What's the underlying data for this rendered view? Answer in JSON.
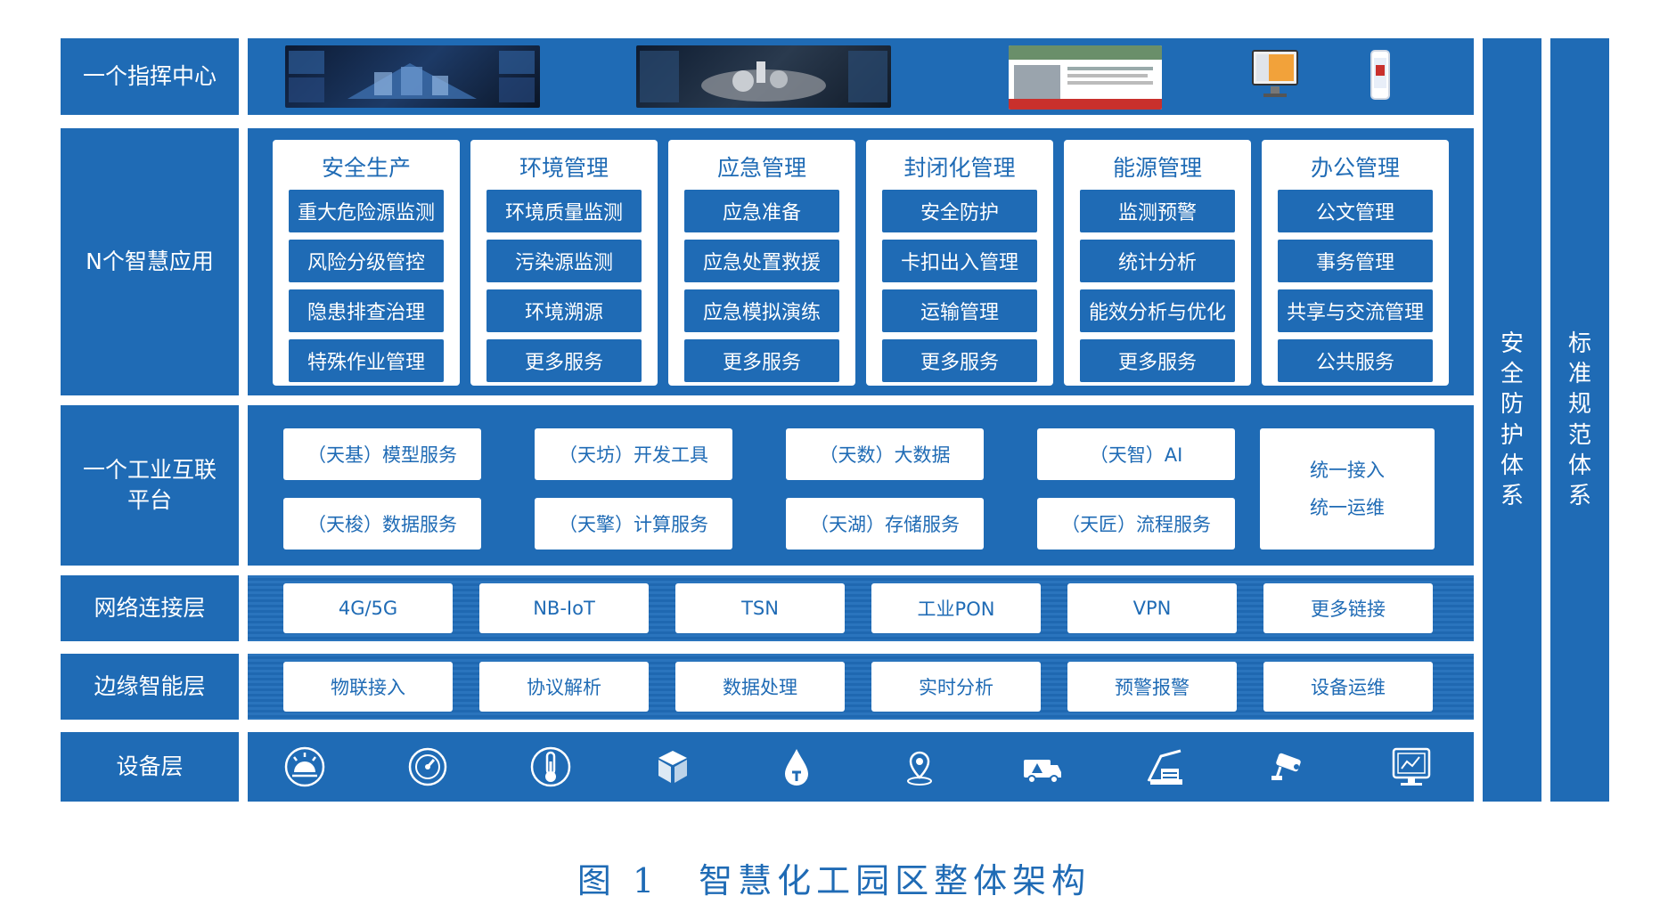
{
  "rows": {
    "command": "一个指挥中心",
    "apps": "N个智慧应用",
    "platform_line1": "一个工业互联",
    "platform_line2": "平台",
    "network": "网络连接层",
    "edge": "边缘智能层",
    "device": "设备层"
  },
  "apps": [
    {
      "title": "安全生产",
      "items": [
        "重大危险源监测",
        "风险分级管控",
        "隐患排查治理",
        "特殊作业管理"
      ]
    },
    {
      "title": "环境管理",
      "items": [
        "环境质量监测",
        "污染源监测",
        "环境溯源",
        "更多服务"
      ]
    },
    {
      "title": "应急管理",
      "items": [
        "应急准备",
        "应急处置救援",
        "应急模拟演练",
        "更多服务"
      ]
    },
    {
      "title": "封闭化管理",
      "items": [
        "安全防护",
        "卡扣出入管理",
        "运输管理",
        "更多服务"
      ]
    },
    {
      "title": "能源管理",
      "items": [
        "监测预警",
        "统计分析",
        "能效分析与优化",
        "更多服务"
      ]
    },
    {
      "title": "办公管理",
      "items": [
        "公文管理",
        "事务管理",
        "共享与交流管理",
        "公共服务"
      ]
    }
  ],
  "platform": {
    "services": [
      "（天基）模型服务",
      "（天坊）开发工具",
      "（天数）大数据",
      "（天智）AI",
      "（天梭）数据服务",
      "（天擎）计算服务",
      "（天湖）存储服务",
      "（天匠）流程服务"
    ],
    "unified_1": "统一接入",
    "unified_2": "统一运维"
  },
  "network": [
    "4G/5G",
    "NB-IoT",
    "TSN",
    "工业PON",
    "VPN",
    "更多链接"
  ],
  "edge": [
    "物联接入",
    "协议解析",
    "数据处理",
    "实时分析",
    "预警报警",
    "设备运维"
  ],
  "devices": [
    "sun-sensor-icon",
    "gauge-icon",
    "thermometer-icon",
    "cube-package-icon",
    "water-drop-icon",
    "location-pin-icon",
    "truck-alert-icon",
    "crane-icon",
    "security-camera-icon",
    "monitor-terminal-icon"
  ],
  "side": {
    "security": [
      "安",
      "全",
      "防",
      "护",
      "体",
      "系"
    ],
    "standards": [
      "标",
      "准",
      "规",
      "范",
      "体",
      "系"
    ]
  },
  "caption": "图 1　智慧化工园区整体架构",
  "colors": {
    "primary": "#1f6bb5",
    "white": "#ffffff"
  }
}
